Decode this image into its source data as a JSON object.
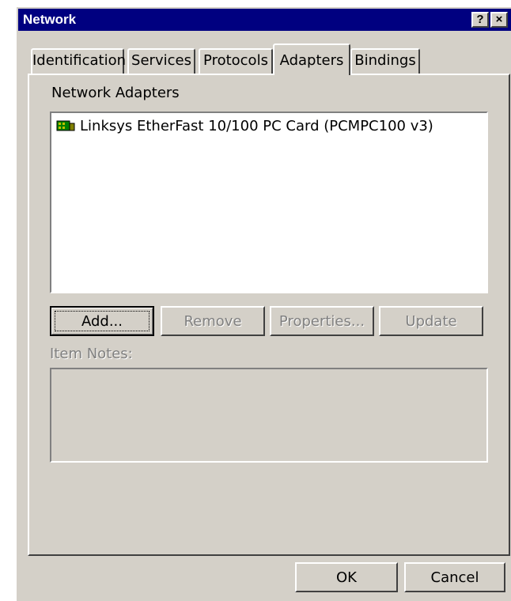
{
  "window": {
    "title": "Network",
    "help_label": "?",
    "close_label": "×"
  },
  "tabs": [
    {
      "label": "Identification",
      "active": false
    },
    {
      "label": "Services",
      "active": false
    },
    {
      "label": "Protocols",
      "active": false
    },
    {
      "label": "Adapters",
      "active": true
    },
    {
      "label": "Bindings",
      "active": false
    }
  ],
  "adapters_panel": {
    "group_label": "Network Adapters",
    "items": [
      {
        "name": "Linksys EtherFast 10/100 PC Card (PCMPC100 v3)",
        "icon": "network-adapter-icon"
      }
    ],
    "buttons": {
      "add": "Add...",
      "remove": "Remove",
      "properties": "Properties...",
      "update": "Update"
    },
    "notes_label": "Item Notes:"
  },
  "footer": {
    "ok": "OK",
    "cancel": "Cancel"
  },
  "colors": {
    "face": "#d4d0c8",
    "titlebar": "#000080",
    "disabled_text": "#808080"
  }
}
